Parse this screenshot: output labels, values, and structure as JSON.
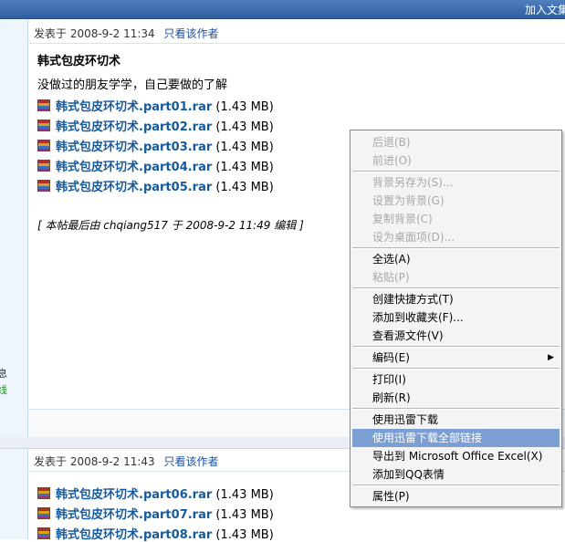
{
  "topbar": {
    "join_text": "加入文集"
  },
  "left_gutter": {
    "glyph1": "息",
    "glyph2": "线"
  },
  "post1": {
    "meta": {
      "posted": "发表于  2008-9-2 11:34",
      "only_author": "只看该作者"
    },
    "title": "韩式包皮环切术",
    "desc": "没做过的朋友学学，自己要做的了解",
    "files": [
      {
        "name": "韩式包皮环切术.part01.rar",
        "size": "(1.43 MB)"
      },
      {
        "name": "韩式包皮环切术.part02.rar",
        "size": "(1.43 MB)"
      },
      {
        "name": "韩式包皮环切术.part03.rar",
        "size": "(1.43 MB)"
      },
      {
        "name": "韩式包皮环切术.part04.rar",
        "size": "(1.43 MB)"
      },
      {
        "name": "韩式包皮环切术.part05.rar",
        "size": "(1.43 MB)"
      }
    ],
    "edit_note": "[ 本帖最后由 chqiang517 于 2008-9-2 11:49 编辑 ]"
  },
  "post2": {
    "meta": {
      "posted": "发表于  2008-9-2 11:43",
      "only_author": "只看该作者"
    },
    "files": [
      {
        "name": "韩式包皮环切术.part06.rar",
        "size": "(1.43 MB)"
      },
      {
        "name": "韩式包皮环切术.part07.rar",
        "size": "(1.43 MB)"
      },
      {
        "name": "韩式包皮环切术.part08.rar",
        "size": "(1.43 MB)"
      }
    ]
  },
  "context_menu": {
    "items": [
      {
        "label": "后退(B)",
        "disabled": true
      },
      {
        "label": "前进(O)",
        "disabled": true
      },
      {
        "label": "背景另存为(S)...",
        "disabled": true
      },
      {
        "label": "设置为背景(G)",
        "disabled": true
      },
      {
        "label": "复制背景(C)",
        "disabled": true
      },
      {
        "label": "设为桌面项(D)...",
        "disabled": true
      },
      {
        "label": "全选(A)",
        "disabled": false
      },
      {
        "label": "粘贴(P)",
        "disabled": true
      },
      {
        "label": "创建快捷方式(T)",
        "disabled": false
      },
      {
        "label": "添加到收藏夹(F)...",
        "disabled": false
      },
      {
        "label": "查看源文件(V)",
        "disabled": false
      },
      {
        "label": "编码(E)",
        "disabled": false,
        "submenu": true
      },
      {
        "label": "打印(I)",
        "disabled": false
      },
      {
        "label": "刷新(R)",
        "disabled": false
      },
      {
        "label": "使用迅雷下载",
        "disabled": false
      },
      {
        "label": "使用迅雷下载全部链接",
        "disabled": false,
        "highlighted": true
      },
      {
        "label": "导出到 Microsoft Office Excel(X)",
        "disabled": false
      },
      {
        "label": "添加到QQ表情",
        "disabled": false
      },
      {
        "label": "属性(P)",
        "disabled": false
      }
    ],
    "submenu_arrow": "▶"
  },
  "colors": {
    "link": "#155a9c",
    "menu_highlight": "#7b9fd2",
    "disabled_text": "#a8a8a8"
  }
}
